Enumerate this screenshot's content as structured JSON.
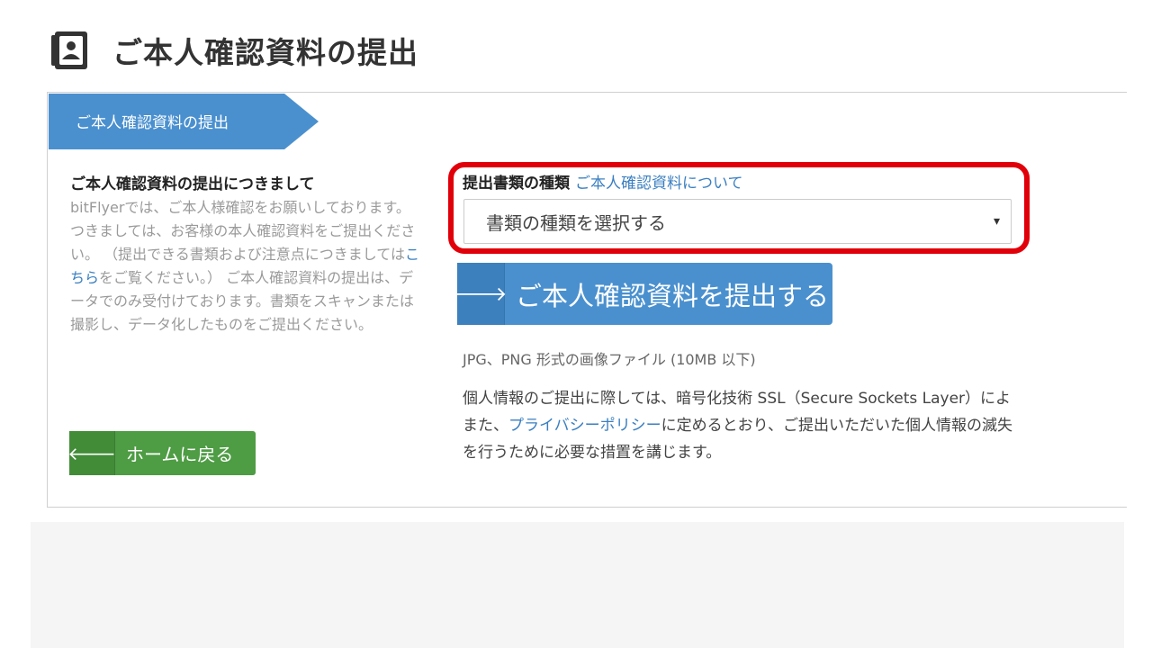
{
  "header": {
    "title": "ご本人確認資料の提出",
    "icon": "id-card-icon"
  },
  "step": {
    "label": "ご本人確認資料の提出"
  },
  "info": {
    "heading": "ご本人確認資料の提出につきまして",
    "body_before_link": "bitFlyerでは、ご本人様確認をお願いしております。つきましては、お客様の本人確認資料をご提出ください。 （提出できる書類および注意点につきましては",
    "link": "こちら",
    "body_after_link": "をご覧ください。） ご本人確認資料の提出は、データでのみ受付けております。書類をスキャンまたは撮影し、データ化したものをご提出ください。"
  },
  "home_button": {
    "label": "ホームに戻る",
    "icon": "arrow-left-icon"
  },
  "form": {
    "field_label": "提出書類の種類",
    "field_link": "ご本人確認資料について",
    "select_value": "書類の種類を選択する",
    "select_arrow": "▾"
  },
  "submit_button": {
    "label": "ご本人確認資料を提出する",
    "icon": "arrow-right-icon"
  },
  "file_note": "JPG、PNG 形式の画像ファイル (10MB 以下)",
  "privacy": {
    "line1": "個人情報のご提出に際しては、暗号化技術 SSL（Secure Sockets Layer）によ",
    "line2_before": "また、",
    "line2_link": "プライバシーポリシー",
    "line2_after": "に定めるとおり、ご提出いただいた個人情報の滅失",
    "line3": "を行うために必要な措置を講じます。"
  },
  "colors": {
    "accent_blue": "#4a90cf",
    "home_green": "#4e9c44",
    "highlight_red": "#e1000a",
    "link_blue": "#3a7fc1"
  }
}
